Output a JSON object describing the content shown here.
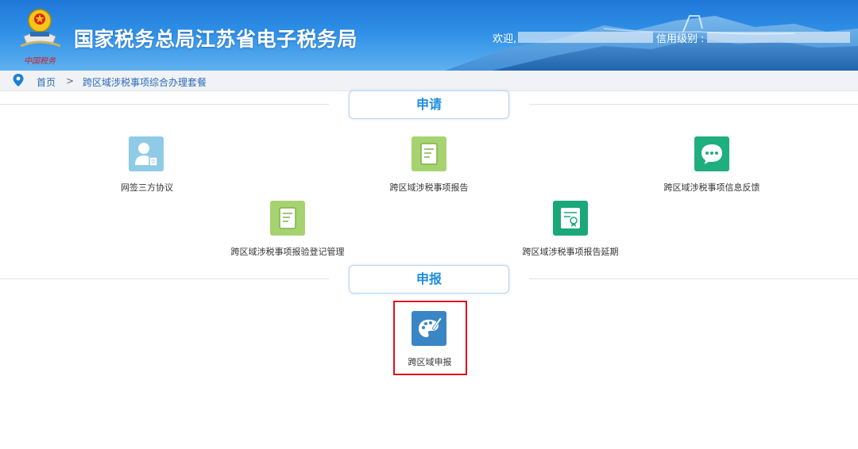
{
  "header": {
    "site_title": "国家税务总局江苏省电子税务局",
    "emblem_caption": "中国税务",
    "welcome_label": "欢迎,",
    "credit_label": "信用级别 :"
  },
  "breadcrumb": {
    "home": "首页",
    "separator": ">",
    "current": "跨区域涉税事项综合办理套餐"
  },
  "sections": {
    "apply": "申请",
    "declare": "申报"
  },
  "tiles": {
    "online_sign": "网签三方协议",
    "report": "跨区域涉税事项报告",
    "feedback": "跨区域涉税事项信息反馈",
    "verify_register": "跨区域涉税事项报验登记管理",
    "extension": "跨区域涉税事项报告延期",
    "cross_declare": "跨区域申报"
  },
  "colors": {
    "header_blue": "#2f8fe6",
    "section_text": "#1f8de0",
    "icon_light_blue": "#8fcbe6",
    "icon_light_green": "#a6d36f",
    "icon_teal": "#1fae7e",
    "icon_green": "#1aa77a",
    "icon_steel_blue": "#3a86c4",
    "highlight_red": "#e0121b"
  }
}
